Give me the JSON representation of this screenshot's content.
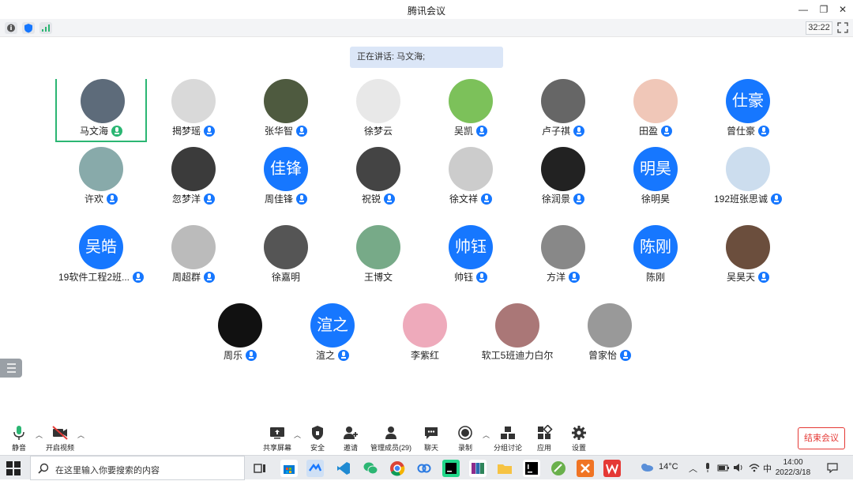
{
  "window": {
    "title": "腾讯会议",
    "timer": "32:22"
  },
  "speaking": "正在讲话: 马文海;",
  "participants": [
    {
      "name": "马文海",
      "avatar_text": "",
      "mic": "green",
      "active": true
    },
    {
      "name": "揭梦瑶",
      "avatar_text": "",
      "mic": "blue"
    },
    {
      "name": "张华智",
      "avatar_text": "",
      "mic": "blue"
    },
    {
      "name": "徐梦云",
      "avatar_text": "",
      "mic": ""
    },
    {
      "name": "吴凯",
      "avatar_text": "",
      "mic": "blue"
    },
    {
      "name": "卢子祺",
      "avatar_text": "",
      "mic": "blue"
    },
    {
      "name": "田盈",
      "avatar_text": "",
      "mic": "blue"
    },
    {
      "name": "曾仕豪",
      "avatar_text": "仕豪",
      "mic": "blue"
    },
    {
      "name": "许欢",
      "avatar_text": "",
      "mic": "blue"
    },
    {
      "name": "忽梦洋",
      "avatar_text": "",
      "mic": "blue"
    },
    {
      "name": "周佳锋",
      "avatar_text": "佳锋",
      "mic": "blue"
    },
    {
      "name": "祝锐",
      "avatar_text": "",
      "mic": "blue"
    },
    {
      "name": "徐文祥",
      "avatar_text": "",
      "mic": "blue"
    },
    {
      "name": "徐润景",
      "avatar_text": "",
      "mic": "blue"
    },
    {
      "name": "徐明昊",
      "avatar_text": "明昊",
      "mic": ""
    },
    {
      "name": "192班张思诚",
      "avatar_text": "",
      "mic": "blue"
    },
    {
      "name": "19软件工程2班...",
      "avatar_text": "吴皓",
      "mic": "blue"
    },
    {
      "name": "周超群",
      "avatar_text": "",
      "mic": "blue"
    },
    {
      "name": "徐嘉明",
      "avatar_text": "",
      "mic": ""
    },
    {
      "name": "王博文",
      "avatar_text": "",
      "mic": ""
    },
    {
      "name": "帅钰",
      "avatar_text": "帅钰",
      "mic": "blue"
    },
    {
      "name": "方洋",
      "avatar_text": "",
      "mic": "blue"
    },
    {
      "name": "陈刚",
      "avatar_text": "陈刚",
      "mic": ""
    },
    {
      "name": "吴昊天",
      "avatar_text": "",
      "mic": "blue"
    },
    {
      "name": "周乐",
      "avatar_text": "",
      "mic": "blue"
    },
    {
      "name": "渲之",
      "avatar_text": "渲之",
      "mic": "blue"
    },
    {
      "name": "李紫红",
      "avatar_text": "",
      "mic": ""
    },
    {
      "name": "软工5班迪力白尔",
      "avatar_text": "",
      "mic": ""
    },
    {
      "name": "曾家怡",
      "avatar_text": "",
      "mic": "blue"
    }
  ],
  "toolbar": {
    "mute": "静音",
    "video": "开启视频",
    "share": "共享屏幕",
    "security": "安全",
    "invite": "邀请",
    "members": "管理成员(29)",
    "chat": "聊天",
    "record": "录制",
    "breakout": "分组讨论",
    "apps": "应用",
    "settings": "设置",
    "end": "结束会议"
  },
  "taskbar": {
    "search_placeholder": "在这里输入你要搜索的内容",
    "weather": "14°C",
    "ime": "中",
    "time": "14:00",
    "date": "2022/3/18"
  },
  "colors": {
    "accent": "#1677ff",
    "active_border": "#2bb673",
    "end_button": "#e53935"
  }
}
